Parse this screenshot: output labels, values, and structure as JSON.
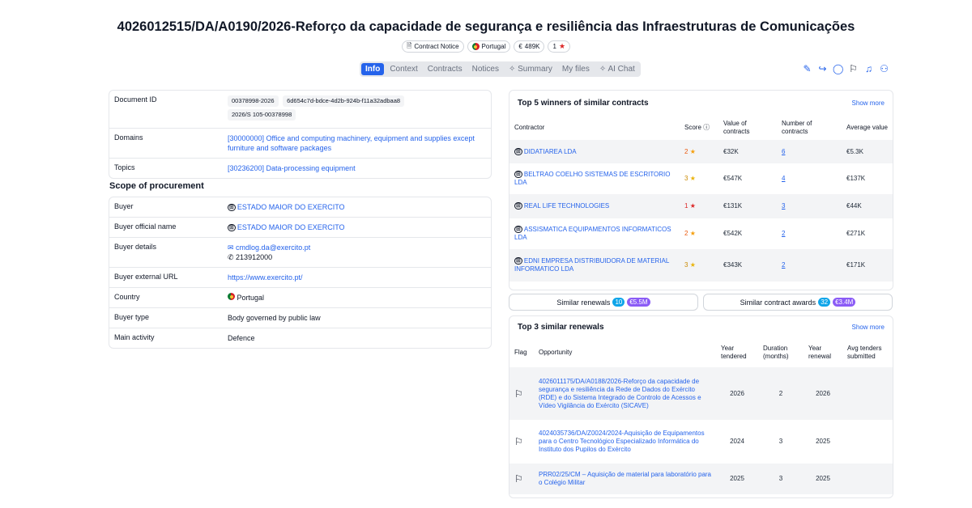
{
  "title": "4026012515/DA/A0190/2026-Reforço da capacidade de segurança e resiliência das Infraestruturas de Comunicações",
  "badges": {
    "notice": "Contract Notice",
    "country": "Portugal",
    "value": "489K",
    "stars": "1"
  },
  "tabs": [
    "Info",
    "Context",
    "Contracts",
    "Notices",
    "Summary",
    "My files",
    "AI Chat"
  ],
  "toolbar_icons": [
    "edit-icon",
    "share-icon",
    "chat-icon",
    "flag-icon",
    "bell-icon",
    "add-user-icon"
  ],
  "document": {
    "rows": [
      {
        "key": "Document ID",
        "chips": [
          "00378998-2026",
          "6d654c7d-bdce-4d2b-924b-f11a32adbaa8",
          "2026/S 105-00378998"
        ]
      },
      {
        "key": "Domains",
        "value": "[30000000] Office and computing machinery, equipment and supplies except furniture and software packages"
      },
      {
        "key": "Topics",
        "value": "[30236200] Data-processing equipment"
      }
    ]
  },
  "scope": {
    "heading": "Scope of procurement",
    "buyer_key": "Buyer",
    "buyer": "ESTADO MAIOR DO EXERCITO",
    "official_key": "Buyer official name",
    "official": "ESTADO MAIOR DO EXERCITO",
    "details_key": "Buyer details",
    "email": "cmdlog.da@exercito.pt",
    "phone": "213912000",
    "url_key": "Buyer external URL",
    "url": "https://www.exercito.pt/",
    "country_key": "Country",
    "country": "Portugal",
    "type_key": "Buyer type",
    "type": "Body governed by public law",
    "activity_key": "Main activity",
    "activity": "Defence"
  },
  "winners": {
    "title": "Top 5 winners of similar contracts",
    "show_more": "Show more",
    "headers": [
      "Contractor",
      "Score",
      "Value of contracts",
      "Number of contracts",
      "Average value"
    ],
    "rows": [
      {
        "name": "DIDATIAREA LDA",
        "score": "2",
        "value": "€32K",
        "count": "6",
        "avg": "€5.3K"
      },
      {
        "name": "BELTRAO COELHO SISTEMAS DE ESCRITORIO LDA",
        "score": "3",
        "value": "€547K",
        "count": "4",
        "avg": "€137K"
      },
      {
        "name": "REAL LIFE TECHNOLOGIES",
        "score": "1",
        "value": "€131K",
        "count": "3",
        "avg": "€44K"
      },
      {
        "name": "ASSISMATICA EQUIPAMENTOS INFORMATICOS LDA",
        "score": "2",
        "value": "€542K",
        "count": "2",
        "avg": "€271K"
      },
      {
        "name": "EDNI EMPRESA DISTRIBUIDORA DE MATERIAL INFORMATICO LDA",
        "score": "3",
        "value": "€343K",
        "count": "2",
        "avg": "€171K"
      }
    ]
  },
  "similar": {
    "renewals_label": "Similar renewals",
    "renewals_count": "10",
    "renewals_amount": "€5.5M",
    "awards_label": "Similar contract awards",
    "awards_count": "32",
    "awards_amount": "€3.4M"
  },
  "renewals": {
    "title": "Top 3 similar renewals",
    "show_more": "Show more",
    "headers": [
      "Flag",
      "Opportunity",
      "Year tendered",
      "Duration (months)",
      "Year renewal",
      "Avg tenders submitted"
    ],
    "rows": [
      {
        "opportunity": "4026011175/DA/A0188/2026-Reforço da capacidade de segurança e resiliência da Rede de Dados do Exército (RDE) e do Sistema Integrado de Controlo de Acessos e Vídeo Vigilância do Exército (SICAVE)",
        "tendered": "2026",
        "duration": "2",
        "renewal": "2026",
        "avg": ""
      },
      {
        "opportunity": "4024035736/DA/Z0024/2024-Aquisição de Equipamentos para o Centro Tecnológico Especializado Informática do Instituto dos Pupilos do Exército",
        "tendered": "2024",
        "duration": "3",
        "renewal": "2025",
        "avg": ""
      },
      {
        "opportunity": "PRR02/25/CM – Aquisição de material para laboratório para o Colégio Militar",
        "tendered": "2025",
        "duration": "3",
        "renewal": "2025",
        "avg": ""
      }
    ]
  }
}
